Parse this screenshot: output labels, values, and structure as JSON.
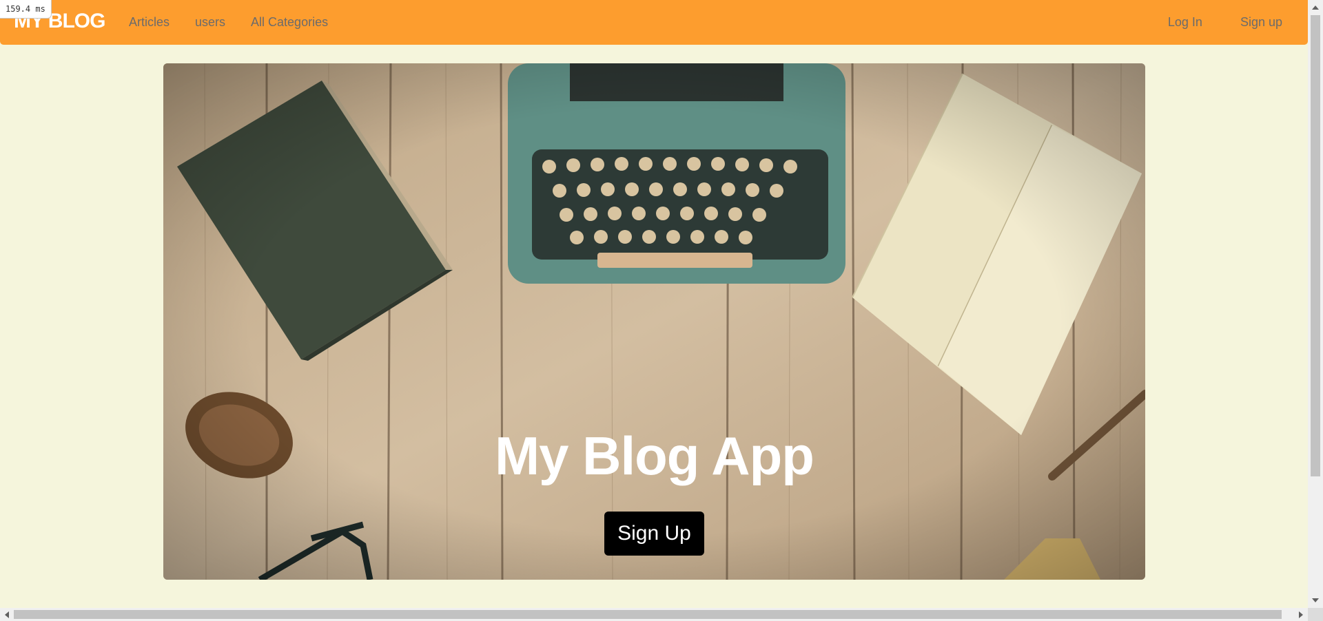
{
  "timing": "159.4 ms",
  "navbar": {
    "brand": "MY BLOG",
    "left_links": [
      {
        "label": "Articles"
      },
      {
        "label": "users"
      },
      {
        "label": "All Categories"
      }
    ],
    "right_links": [
      {
        "label": "Log In"
      },
      {
        "label": "Sign up"
      }
    ],
    "colors": {
      "background": "#fd9d2e",
      "link": "#6b6b6b",
      "brand": "#ffffff"
    }
  },
  "hero": {
    "title": "My Blog App",
    "button_label": "Sign Up",
    "image_description_icons": [
      "typewriter-illustration",
      "book-illustration",
      "notebook-illustration",
      "pinecone-illustration",
      "glasses-illustration"
    ]
  },
  "page": {
    "background": "#f5f5dc"
  }
}
